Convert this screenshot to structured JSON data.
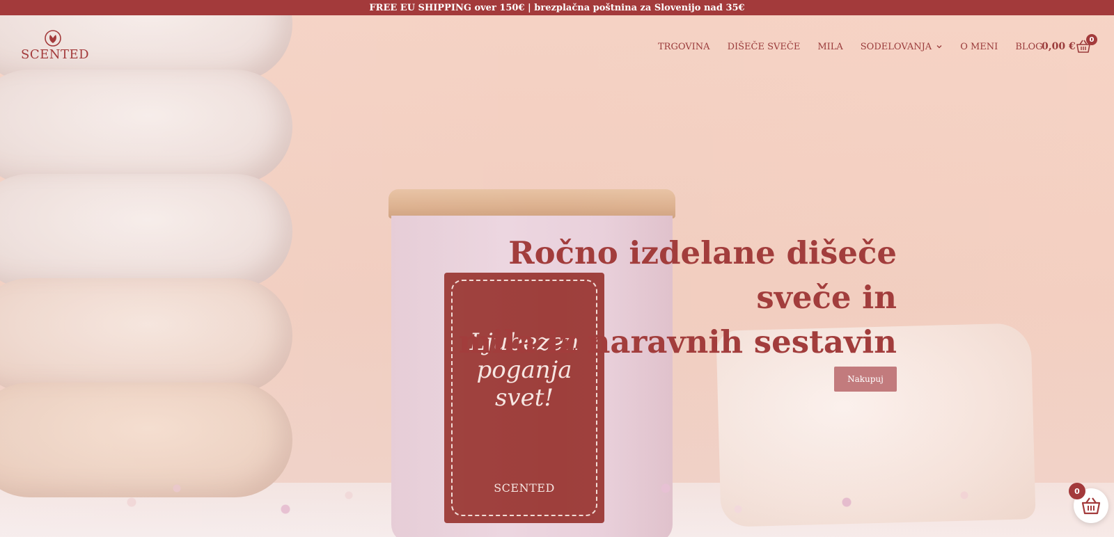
{
  "announcement": {
    "text": "FREE EU SHIPPING over 150€ | brezplačna poštnina za Slovenijo nad 35€"
  },
  "header": {
    "logo_text": "SCENTED",
    "nav": [
      {
        "label": "TRGOVINA"
      },
      {
        "label": "DIŠEČE SVEČE"
      },
      {
        "label": "MILA"
      },
      {
        "label": "SODELOVANJA",
        "has_dropdown": true
      },
      {
        "label": "O MENI"
      },
      {
        "label": "BLOG"
      }
    ],
    "cart_total": "0,00 €",
    "cart_count": "0"
  },
  "hero": {
    "title_lines": [
      "Ročno izdelane dišeče",
      "sveče in",
      "mila iz naravnih sestavin"
    ],
    "cta_label": "Nakupuj",
    "label_script": [
      "Ljubezen",
      "poganja",
      "svet!"
    ],
    "label_brand": "SCENTED"
  },
  "floating_cart": {
    "count": "0"
  },
  "colors": {
    "brand": "#a33a3b",
    "title": "#a23d3c",
    "cta": "#c27b7d",
    "hero_bg": "#f3cfc1"
  },
  "icons": {
    "logo": "rose-icon",
    "dropdown": "chevron-down-icon",
    "cart": "basket-icon"
  }
}
